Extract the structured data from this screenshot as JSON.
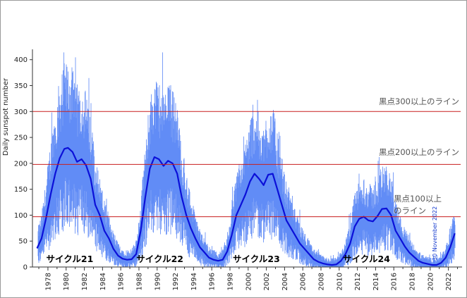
{
  "chart_data": {
    "type": "line",
    "xlabel": "",
    "ylabel": "Daily sunspot number",
    "xlim": [
      1976.3,
      2023.5
    ],
    "ylim": [
      0,
      420
    ],
    "yticks": [
      0,
      50,
      100,
      150,
      200,
      250,
      300,
      350,
      400
    ],
    "xticks": [
      "1978",
      "1980",
      "1982",
      "1984",
      "1986",
      "1988",
      "1990",
      "1992",
      "1994",
      "1996",
      "1998",
      "2000",
      "2002",
      "2004",
      "2006",
      "2008",
      "2010",
      "2012",
      "2014",
      "2016",
      "2018",
      "2020",
      "2022"
    ],
    "colors": {
      "daily": "#5b87f5",
      "smoothed": "#0b10d8",
      "reference": "#c81e1e",
      "stamp": "#1a3fd0"
    },
    "reference_lines": [
      {
        "value": 300,
        "label": "黒点300以上のライン"
      },
      {
        "value": 198,
        "label": "黒点200以上のライン"
      },
      {
        "value": 97,
        "label_lines": [
          "黒点100以上",
          "のライン"
        ]
      }
    ],
    "cycle_labels": [
      {
        "text": "サイクル21",
        "x": 1980.4
      },
      {
        "text": "サイクル22",
        "x": 1990.3
      },
      {
        "text": "サイクル23",
        "x": 2000.9
      },
      {
        "text": "サイクル24",
        "x": 2013.0
      }
    ],
    "stamp": "30 November 2022",
    "series": [
      {
        "name": "smoothed",
        "x": [
          1976.8,
          1977.3,
          1977.8,
          1978.3,
          1978.8,
          1979.3,
          1979.8,
          1980.2,
          1980.7,
          1981.2,
          1981.7,
          1982.2,
          1982.7,
          1983.2,
          1983.7,
          1984.2,
          1984.7,
          1985.2,
          1985.7,
          1986.2,
          1986.7,
          1987.2,
          1987.7,
          1988.2,
          1988.7,
          1989.2,
          1989.7,
          1990.2,
          1990.7,
          1991.2,
          1991.7,
          1992.2,
          1992.7,
          1993.2,
          1993.7,
          1994.2,
          1994.7,
          1995.2,
          1995.7,
          1996.2,
          1996.7,
          1997.2,
          1997.7,
          1998.2,
          1998.7,
          1999.2,
          1999.7,
          2000.2,
          2000.7,
          2001.2,
          2001.7,
          2002.2,
          2002.7,
          2003.2,
          2003.7,
          2004.2,
          2004.7,
          2005.2,
          2005.7,
          2006.2,
          2006.7,
          2007.2,
          2007.7,
          2008.2,
          2008.7,
          2009.2,
          2009.7,
          2010.2,
          2010.7,
          2011.2,
          2011.7,
          2012.2,
          2012.7,
          2013.2,
          2013.7,
          2014.2,
          2014.7,
          2015.2,
          2015.7,
          2016.2,
          2016.7,
          2017.2,
          2017.7,
          2018.2,
          2018.7,
          2019.2,
          2019.7,
          2020.2,
          2020.7,
          2021.2,
          2021.7,
          2022.2,
          2022.7
        ],
        "y": [
          36,
          55,
          95,
          140,
          180,
          210,
          228,
          230,
          222,
          203,
          208,
          196,
          170,
          120,
          100,
          70,
          55,
          35,
          22,
          16,
          14,
          15,
          25,
          70,
          135,
          190,
          212,
          208,
          195,
          205,
          200,
          180,
          135,
          100,
          75,
          55,
          38,
          28,
          18,
          14,
          12,
          14,
          30,
          62,
          100,
          120,
          140,
          165,
          180,
          170,
          158,
          178,
          180,
          150,
          120,
          90,
          75,
          60,
          45,
          35,
          25,
          15,
          10,
          7,
          5,
          4,
          5,
          12,
          25,
          45,
          78,
          93,
          97,
          90,
          88,
          98,
          112,
          113,
          100,
          70,
          55,
          40,
          28,
          20,
          12,
          8,
          6,
          4,
          4,
          8,
          18,
          38,
          65
        ]
      }
    ]
  }
}
